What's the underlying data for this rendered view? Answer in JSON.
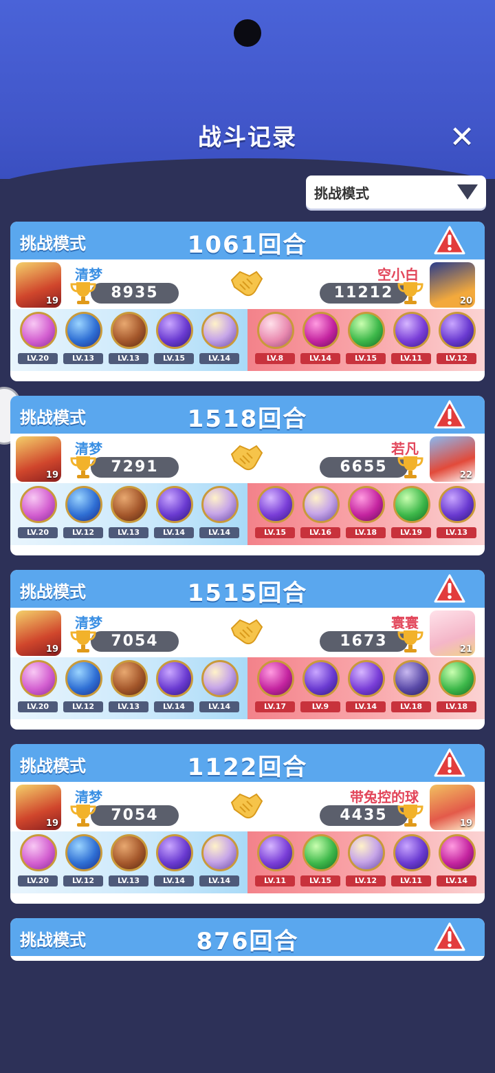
{
  "header": {
    "title": "战斗记录",
    "close_icon": "close-icon"
  },
  "filter": {
    "selected": "挑战模式",
    "icon": "dropdown-arrow-icon"
  },
  "colors": {
    "accent": "#5aa7ee",
    "left_name": "#3a8fe3",
    "right_name": "#e2465a"
  },
  "records": [
    {
      "mode": "挑战模式",
      "rounds": "1061回合",
      "left": {
        "name": "清梦",
        "score": "8935",
        "level": "19",
        "balls": [
          {
            "type": "pink-shield",
            "lv": "LV.20"
          },
          {
            "type": "blue-hex",
            "lv": "LV.13"
          },
          {
            "type": "brown-infinity",
            "lv": "LV.13"
          },
          {
            "type": "purple-lightning",
            "lv": "LV.15"
          },
          {
            "type": "purple-hand",
            "lv": "LV.14"
          }
        ]
      },
      "right": {
        "name": "空小白",
        "score": "11212",
        "level": "20",
        "balls": [
          {
            "type": "pink-character",
            "lv": "LV.8"
          },
          {
            "type": "magenta-feather",
            "lv": "LV.14"
          },
          {
            "type": "green-arrow",
            "lv": "LV.15"
          },
          {
            "type": "purple-butterfly",
            "lv": "LV.11"
          },
          {
            "type": "purple-lightning",
            "lv": "LV.12"
          }
        ]
      }
    },
    {
      "mode": "挑战模式",
      "rounds": "1518回合",
      "left": {
        "name": "清梦",
        "score": "7291",
        "level": "19",
        "balls": [
          {
            "type": "pink-shield",
            "lv": "LV.20"
          },
          {
            "type": "blue-hex",
            "lv": "LV.12"
          },
          {
            "type": "brown-infinity",
            "lv": "LV.13"
          },
          {
            "type": "purple-lightning",
            "lv": "LV.14"
          },
          {
            "type": "purple-hand",
            "lv": "LV.14"
          }
        ]
      },
      "right": {
        "name": "若凡",
        "score": "6655",
        "level": "22",
        "balls": [
          {
            "type": "purple-butterfly",
            "lv": "LV.15"
          },
          {
            "type": "purple-hand",
            "lv": "LV.16"
          },
          {
            "type": "magenta-feather",
            "lv": "LV.18"
          },
          {
            "type": "green-arrow",
            "lv": "LV.19"
          },
          {
            "type": "purple-lightning",
            "lv": "LV.13"
          }
        ]
      }
    },
    {
      "mode": "挑战模式",
      "rounds": "1515回合",
      "left": {
        "name": "清梦",
        "score": "7054",
        "level": "19",
        "balls": [
          {
            "type": "pink-shield",
            "lv": "LV.20"
          },
          {
            "type": "blue-hex",
            "lv": "LV.12"
          },
          {
            "type": "brown-infinity",
            "lv": "LV.13"
          },
          {
            "type": "purple-lightning",
            "lv": "LV.14"
          },
          {
            "type": "purple-hand",
            "lv": "LV.14"
          }
        ]
      },
      "right": {
        "name": "寰寰",
        "score": "1673",
        "level": "21",
        "balls": [
          {
            "type": "magenta-feather",
            "lv": "LV.17"
          },
          {
            "type": "purple-lightning",
            "lv": "LV.9"
          },
          {
            "type": "purple-butterfly",
            "lv": "LV.14"
          },
          {
            "type": "purple-ghost",
            "lv": "LV.18"
          },
          {
            "type": "green-arrow",
            "lv": "LV.18"
          }
        ]
      }
    },
    {
      "mode": "挑战模式",
      "rounds": "1122回合",
      "left": {
        "name": "清梦",
        "score": "7054",
        "level": "19",
        "balls": [
          {
            "type": "pink-shield",
            "lv": "LV.20"
          },
          {
            "type": "blue-hex",
            "lv": "LV.12"
          },
          {
            "type": "brown-infinity",
            "lv": "LV.13"
          },
          {
            "type": "purple-lightning",
            "lv": "LV.14"
          },
          {
            "type": "purple-hand",
            "lv": "LV.14"
          }
        ]
      },
      "right": {
        "name": "带兔控的球",
        "score": "4435",
        "level": "19",
        "balls": [
          {
            "type": "purple-butterfly",
            "lv": "LV.11"
          },
          {
            "type": "green-arrow",
            "lv": "LV.15"
          },
          {
            "type": "purple-hand",
            "lv": "LV.12"
          },
          {
            "type": "purple-lightning",
            "lv": "LV.11"
          },
          {
            "type": "magenta-feather",
            "lv": "LV.14"
          }
        ]
      }
    },
    {
      "mode": "挑战模式",
      "rounds": "876回合"
    }
  ]
}
